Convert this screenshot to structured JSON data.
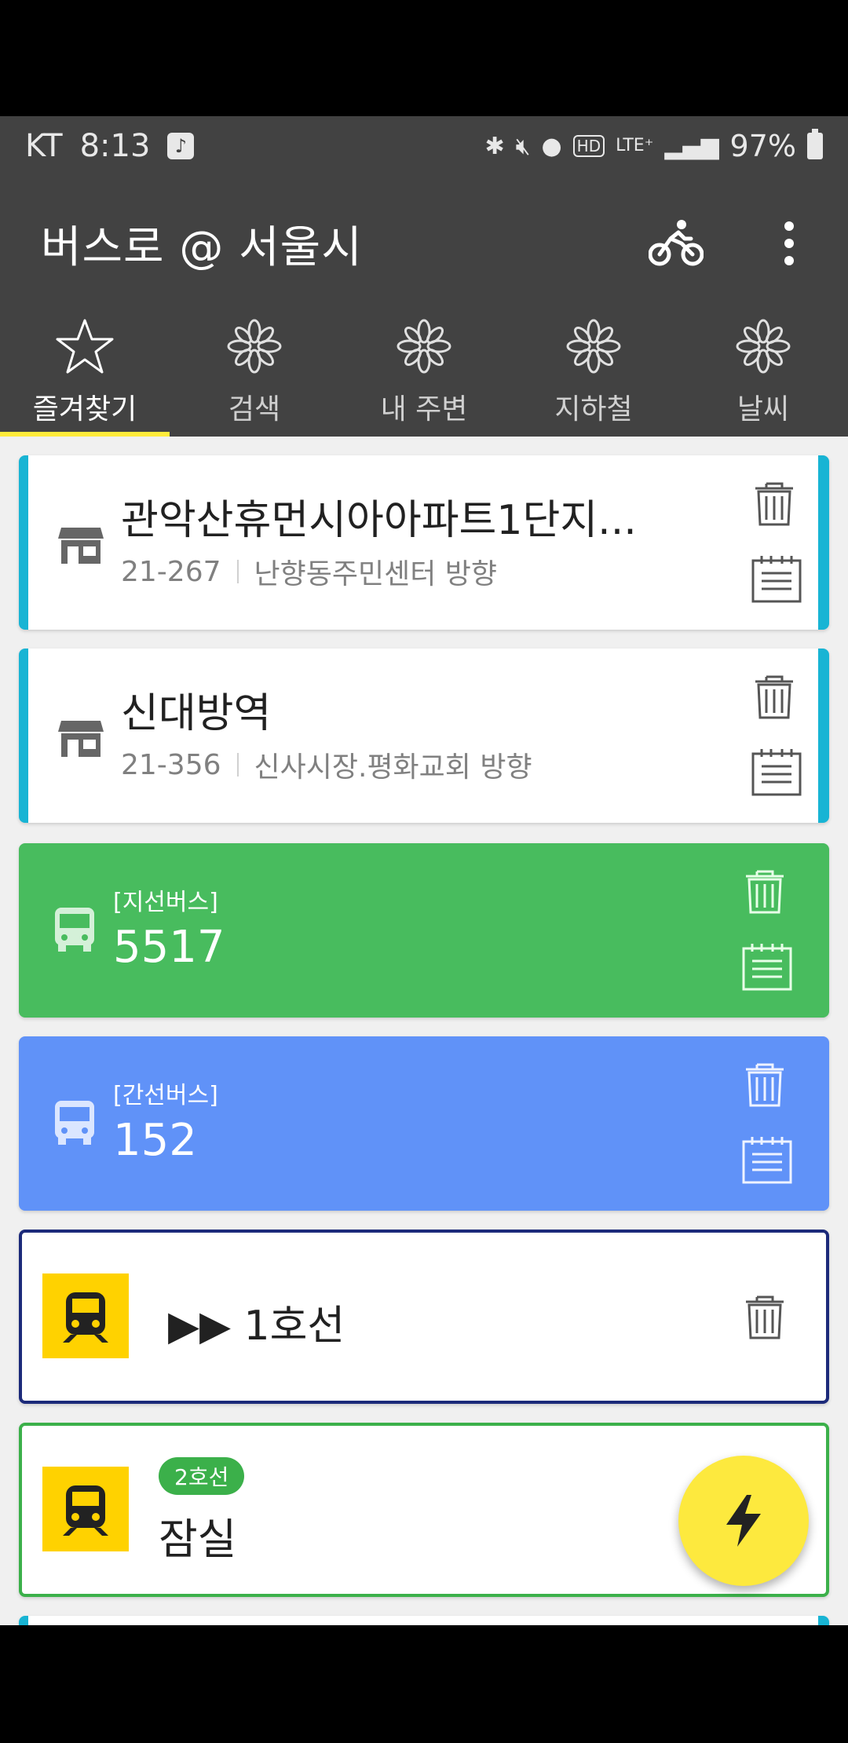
{
  "status_bar": {
    "carrier": "KT",
    "time": "8:13",
    "network": "LTE⁺",
    "battery": "97%"
  },
  "app_bar": {
    "title": "버스로 @ 서울시",
    "icons": [
      "bicycle-icon",
      "more-vert-icon"
    ]
  },
  "tabs": [
    {
      "label": "즐겨찾기",
      "icon": "star-icon",
      "active": true
    },
    {
      "label": "검색",
      "icon": "loading-icon",
      "active": false
    },
    {
      "label": "내 주변",
      "icon": "loading-icon",
      "active": false
    },
    {
      "label": "지하철",
      "icon": "loading-icon",
      "active": false
    },
    {
      "label": "날씨",
      "icon": "loading-icon",
      "active": false
    }
  ],
  "favorites": {
    "stop1": {
      "name": "관악산휴먼시아아파트1단지...",
      "code": "21-267",
      "direction": "난향동주민센터 방향"
    },
    "stop2": {
      "name": "신대방역",
      "code": "21-356",
      "direction": "신사시장.평화교회 방향"
    },
    "bus1": {
      "type": "[지선버스]",
      "number": "5517",
      "color": "#48bc5e"
    },
    "bus2": {
      "type": "[간선버스]",
      "number": "152",
      "color": "#6092f8"
    },
    "subway_line": {
      "label": "▶▶ 1호선",
      "color": "#1c2a7a"
    },
    "station": {
      "badge": "2호선",
      "name": "잠실",
      "color": "#3bb04a"
    }
  },
  "colors": {
    "stop_accent": "#18b4d4",
    "fab": "#fde93e",
    "tab_indicator": "#ffeb3b"
  }
}
